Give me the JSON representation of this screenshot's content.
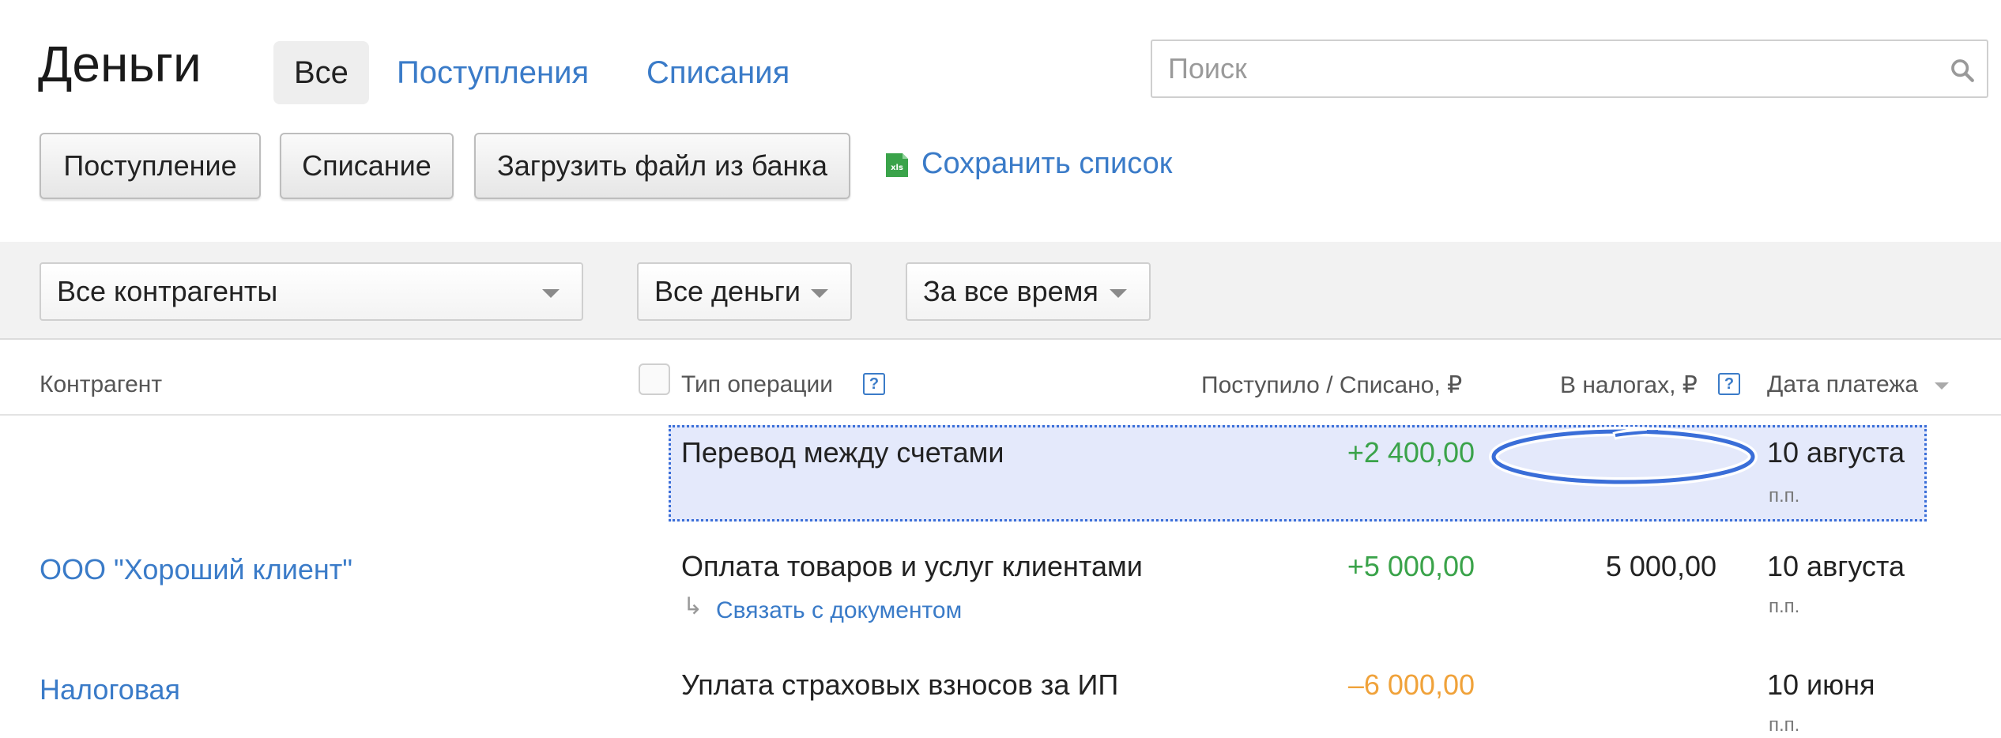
{
  "header": {
    "title": "Деньги",
    "tabs": [
      {
        "label": "Все",
        "active": true
      },
      {
        "label": "Поступления",
        "active": false
      },
      {
        "label": "Списания",
        "active": false
      }
    ],
    "search": {
      "placeholder": "Поиск"
    }
  },
  "toolbar": {
    "income_button": "Поступление",
    "expense_button": "Списание",
    "upload_button": "Загрузить файл из банка",
    "save_link": "Сохранить список",
    "save_icon": "xls-icon"
  },
  "filters": {
    "counterparty": "Все контрагенты",
    "money": "Все деньги",
    "period": "За все время"
  },
  "table": {
    "columns": {
      "counterparty": "Контрагент",
      "operation_type": "Тип операции",
      "amount": "Поступило / Списано, ₽",
      "taxes": "В налогах, ₽",
      "date": "Дата платежа"
    },
    "rows": [
      {
        "counterparty": "",
        "operation": "Перевод между счетами",
        "amount": "+2 400,00",
        "taxes": "",
        "date": "10 августа",
        "doc": "п.п."
      },
      {
        "counterparty": "ООО \"Хороший клиент\"",
        "operation": "Оплата товаров и услуг клиентами",
        "link": "Связать с документом",
        "amount": "+5 000,00",
        "taxes": "5 000,00",
        "date": "10 августа",
        "doc": "п.п."
      },
      {
        "counterparty": "Налоговая",
        "operation": "Уплата страховых взносов за ИП",
        "amount": "–6 000,00",
        "taxes": "",
        "date": "10 июня",
        "doc": "п.п."
      }
    ]
  },
  "colors": {
    "link": "#3a7bc8",
    "income": "#3aa34a",
    "expense": "#f0a23a",
    "highlight": "#e4e9fb",
    "annotation": "#3a6ed8"
  }
}
